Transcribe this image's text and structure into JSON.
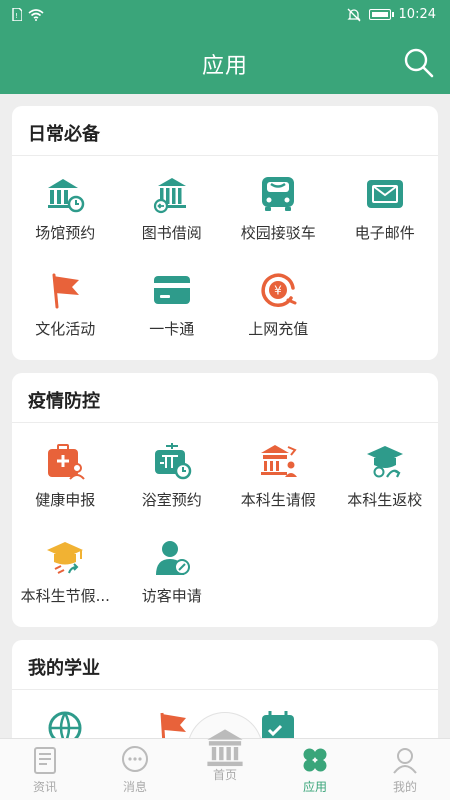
{
  "status_bar": {
    "time": "10:24"
  },
  "header": {
    "title": "应用"
  },
  "sections": [
    {
      "title": "日常必备",
      "items": [
        {
          "label": "场馆预约",
          "icon": "stadium-booking-icon"
        },
        {
          "label": "图书借阅",
          "icon": "library-borrow-icon"
        },
        {
          "label": "校园接驳车",
          "icon": "shuttle-bus-icon"
        },
        {
          "label": "电子邮件",
          "icon": "email-icon"
        },
        {
          "label": "文化活动",
          "icon": "flag-icon"
        },
        {
          "label": "一卡通",
          "icon": "card-icon"
        },
        {
          "label": "上网充值",
          "icon": "recharge-icon"
        }
      ]
    },
    {
      "title": "疫情防控",
      "items": [
        {
          "label": "健康申报",
          "icon": "health-report-icon"
        },
        {
          "label": "浴室预约",
          "icon": "bathroom-booking-icon"
        },
        {
          "label": "本科生请假",
          "icon": "leave-request-icon"
        },
        {
          "label": "本科生返校",
          "icon": "return-school-icon"
        },
        {
          "label": "本科生节假...",
          "icon": "holiday-icon"
        },
        {
          "label": "访客申请",
          "icon": "visitor-icon"
        }
      ]
    },
    {
      "title": "我的学业",
      "items": []
    }
  ],
  "tabs": [
    {
      "label": "资讯",
      "icon": "news-icon"
    },
    {
      "label": "消息",
      "icon": "message-icon"
    },
    {
      "label": "首页",
      "icon": "home-building-icon"
    },
    {
      "label": "应用",
      "icon": "clover-icon",
      "active": true
    },
    {
      "label": "我的",
      "icon": "profile-icon"
    }
  ],
  "colors": {
    "brand": "#3aa57a",
    "teal": "#2e9b8b",
    "orange": "#e8623a",
    "yellow": "#f1b233",
    "inactive": "#aaaaaa"
  }
}
